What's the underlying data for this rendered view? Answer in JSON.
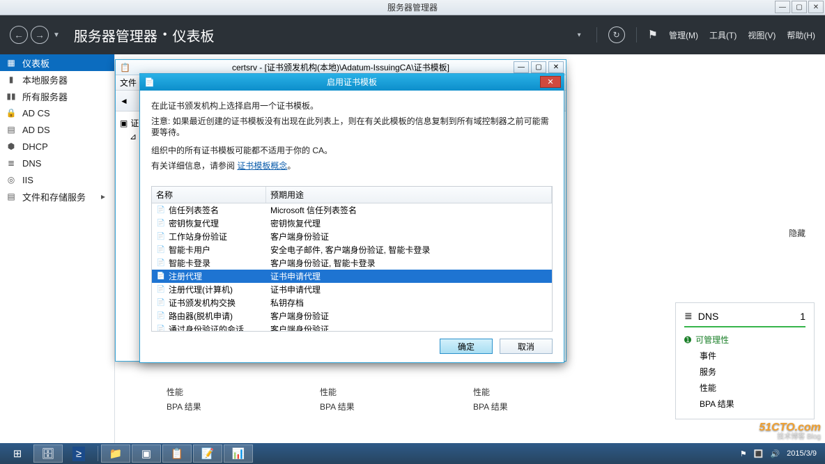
{
  "window": {
    "title": "服务器管理器"
  },
  "header": {
    "bc1": "服务器管理器",
    "bc2": "仪表板",
    "menu": {
      "manage": "管理(M)",
      "tools": "工具(T)",
      "view": "视图(V)",
      "help": "帮助(H)"
    }
  },
  "sidebar": {
    "items": [
      {
        "label": "仪表板"
      },
      {
        "label": "本地服务器"
      },
      {
        "label": "所有服务器"
      },
      {
        "label": "AD CS"
      },
      {
        "label": "AD DS"
      },
      {
        "label": "DHCP"
      },
      {
        "label": "DNS"
      },
      {
        "label": "IIS"
      },
      {
        "label": "文件和存储服务"
      }
    ]
  },
  "mdi": {
    "title": "certsrv - [证书颁发机构(本地)\\Adatum-IssuingCA\\证书模板]",
    "menu_file": "文件",
    "toolbar_back": "◄",
    "tree_root": "证"
  },
  "dialog": {
    "title": "启用证书模板",
    "p1": "在此证书颁发机构上选择启用一个证书模板。",
    "p2": "注意: 如果最近创建的证书模板没有出现在此列表上，则在有关此模板的信息复制到所有域控制器之前可能需要等待。",
    "p3": "组织中的所有证书模板可能都不适用于你的 CA。",
    "p4_pre": "有关详细信息，请参阅 ",
    "p4_link": "证书模板概念",
    "col1": "名称",
    "col2": "预期用途",
    "rows": [
      {
        "name": "信任列表签名",
        "use": "Microsoft 信任列表签名"
      },
      {
        "name": "密钥恢复代理",
        "use": "密钥恢复代理"
      },
      {
        "name": "工作站身份验证",
        "use": "客户端身份验证"
      },
      {
        "name": "智能卡用户",
        "use": "安全电子邮件, 客户端身份验证, 智能卡登录"
      },
      {
        "name": "智能卡登录",
        "use": "客户端身份验证, 智能卡登录"
      },
      {
        "name": "注册代理",
        "use": "证书申请代理"
      },
      {
        "name": "注册代理(计算机)",
        "use": "证书申请代理"
      },
      {
        "name": "证书颁发机构交换",
        "use": "私钥存档"
      },
      {
        "name": "路由器(脱机申请)",
        "use": "客户端身份验证"
      },
      {
        "name": "通过身份验证的会话",
        "use": "客户端身份验证"
      }
    ],
    "selected_index": 5,
    "ok": "确定",
    "cancel": "取消"
  },
  "main": {
    "hide": "隐藏",
    "task_one": "1",
    "perf": "性能",
    "bpa": "BPA 结果",
    "dns": {
      "label": "DNS",
      "count": "1",
      "manage": "可管理性",
      "events": "事件",
      "services": "服务",
      "perf": "性能",
      "bpa": "BPA 结果"
    }
  },
  "tray": {
    "date": "2015/3/9"
  },
  "watermark": {
    "big": "51CTO.com",
    "small": "技术博客  Blog"
  }
}
